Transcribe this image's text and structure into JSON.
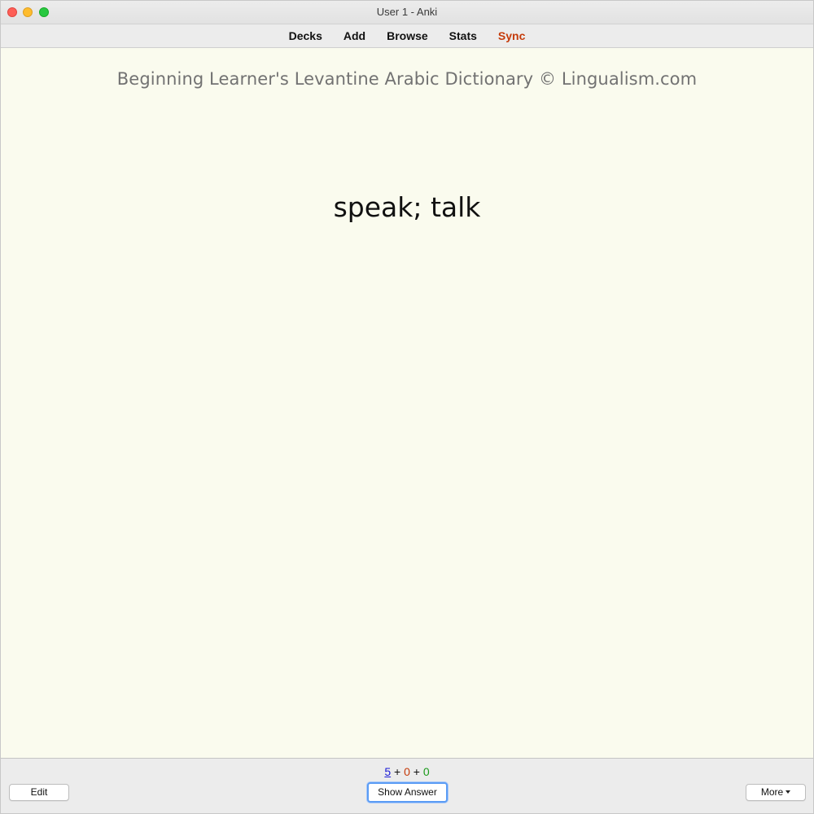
{
  "window": {
    "title": "User 1 - Anki"
  },
  "toolbar": {
    "items": [
      {
        "label": "Decks"
      },
      {
        "label": "Add"
      },
      {
        "label": "Browse"
      },
      {
        "label": "Stats"
      },
      {
        "label": "Sync",
        "color": "#c53b0a"
      }
    ]
  },
  "card": {
    "deck_header": "Beginning Learner's Levantine Arabic Dictionary © Lingualism.com",
    "front_text": "speak; talk"
  },
  "bottom": {
    "counts": {
      "new": "5",
      "learning": "0",
      "review": "0",
      "separator": "+"
    },
    "edit_label": "Edit",
    "show_answer_label": "Show Answer",
    "more_label": "More"
  },
  "colors": {
    "card_background": "#fafbee",
    "new_count": "#1a1ad6",
    "learning_count": "#c53b0a",
    "review_count": "#1a9a1a",
    "focus_ring": "#5b9cf4"
  },
  "icons": {
    "window_controls": [
      "close-icon",
      "minimize-icon",
      "maximize-icon"
    ],
    "more_menu": "caret-down-icon"
  }
}
